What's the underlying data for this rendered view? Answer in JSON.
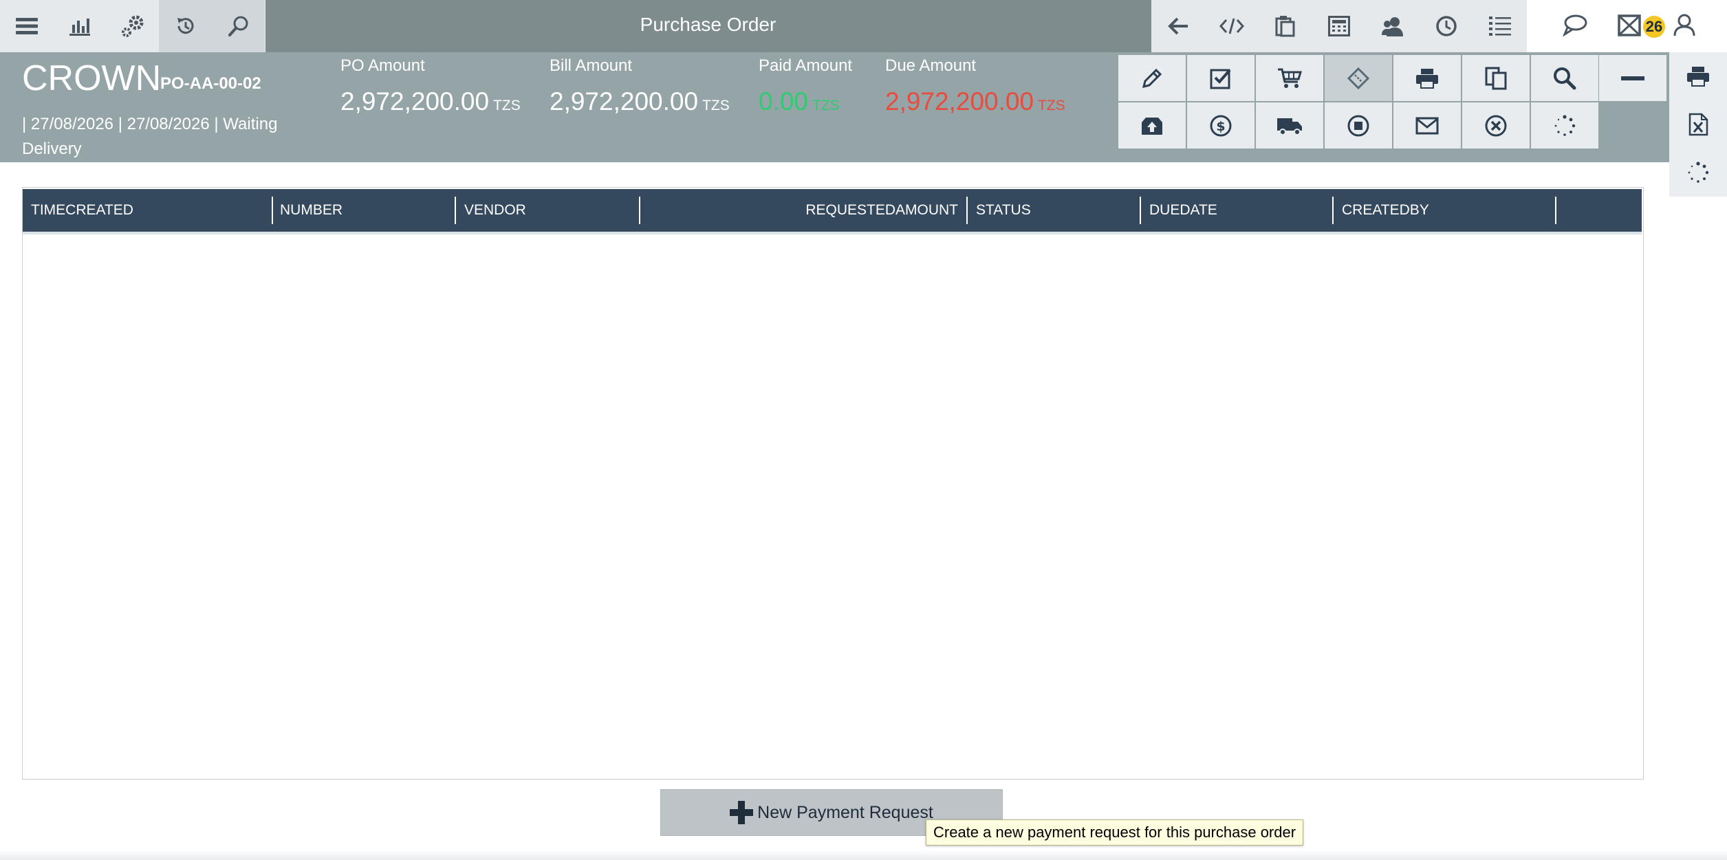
{
  "topbar": {
    "title": "Purchase Order",
    "left_icons": [
      "menu-icon",
      "chart-icon",
      "gears-icon",
      "history-icon",
      "search-icon"
    ],
    "right_icons": [
      "back-arrow-icon",
      "code-icon",
      "clipboard-icon",
      "calculator-icon",
      "users-icon",
      "clock-icon",
      "list-icon"
    ],
    "far_icons": [
      "chat-icon",
      "mail-icon",
      "user-icon"
    ],
    "mail_badge": "26"
  },
  "summary": {
    "vendor": "CROWN",
    "po_number": "PO-AA-00-02",
    "meta": "| 27/08/2026 | 27/08/2026 | Waiting Delivery",
    "amounts": [
      {
        "label": "PO Amount",
        "value": "2,972,200.00",
        "currency": "TZS",
        "color": "#ffffff"
      },
      {
        "label": "Bill Amount",
        "value": "2,972,200.00",
        "currency": "TZS",
        "color": "#ffffff"
      },
      {
        "label": "Paid Amount",
        "value": "0.00",
        "currency": "TZS",
        "color": "#2ecc71"
      },
      {
        "label": "Due Amount",
        "value": "2,972,200.00",
        "currency": "TZS",
        "color": "#e74c3c"
      }
    ]
  },
  "actions": {
    "row1": [
      "pencil-icon",
      "checkbox-icon",
      "cart-icon",
      "ticket-icon",
      "print-icon",
      "copy-icon",
      "magnifier-icon"
    ],
    "row2": [
      "archive-upload-icon",
      "dollar-icon",
      "truck-icon",
      "stop-icon",
      "envelope-icon",
      "close-circle-icon",
      "spinner-icon"
    ],
    "highlight_index": 3,
    "side": [
      "print-icon",
      "excel-icon",
      "spinner-icon"
    ]
  },
  "grid": {
    "columns": [
      "TIMECREATED",
      "NUMBER",
      "VENDOR",
      "REQUESTEDAMOUNT",
      "STATUS",
      "DUEDATE",
      "CREATEDBY"
    ],
    "rows": []
  },
  "new_button": {
    "label": "New Payment Request"
  },
  "tooltip": {
    "text": "Create a new payment request for this purchase order"
  },
  "colors": {
    "header_bar": "#7e8c8d",
    "band": "#95a4a6",
    "grid_header": "#34495e",
    "badge": "#f3c623"
  }
}
